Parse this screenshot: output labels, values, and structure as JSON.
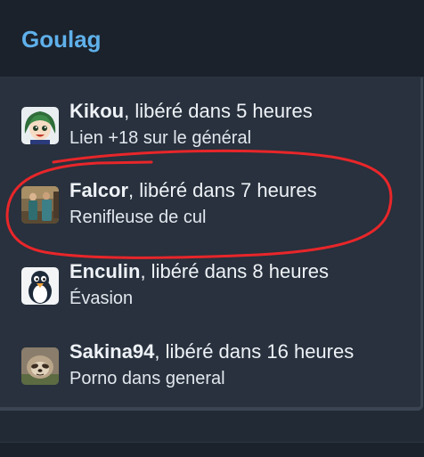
{
  "widget": {
    "title": "Goulag"
  },
  "entries": [
    {
      "name": "Kikou",
      "status": ", libéré dans 5 heures",
      "reason": "Lien +18 sur le général",
      "avatar_icon": "anime-girl-avatar"
    },
    {
      "name": "Falcor",
      "status": ", libéré dans 7 heures",
      "reason": "Renifleuse de cul",
      "avatar_icon": "people-photo-avatar",
      "highlighted": true
    },
    {
      "name": "Enculin",
      "status": ", libéré dans 8 heures",
      "reason": "Évasion",
      "avatar_icon": "penguin-avatar"
    },
    {
      "name": "Sakina94",
      "status": ", libéré dans 16 heures",
      "reason": "Porno dans general",
      "avatar_icon": "sloth-avatar"
    }
  ],
  "colors": {
    "title": "#5fb0ea",
    "panel_bg": "#28313d",
    "header_bg": "#1b222c",
    "text": "#eef2f7",
    "annotation": "#e8262a"
  }
}
